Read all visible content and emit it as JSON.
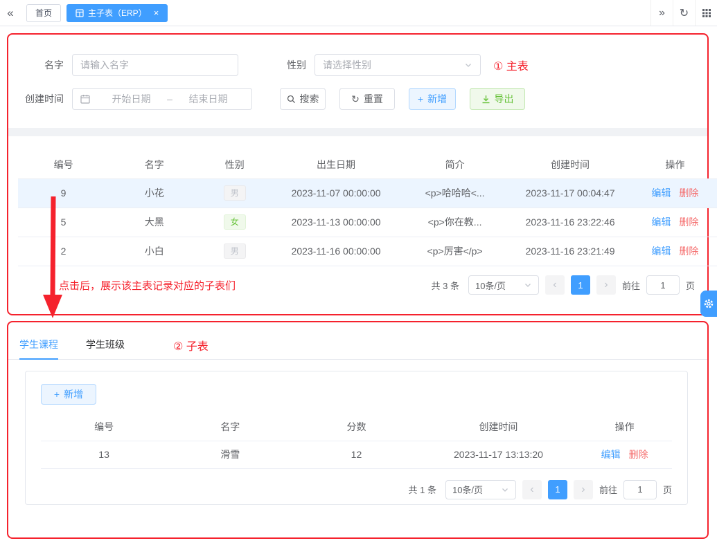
{
  "colors": {
    "primary": "#409eff",
    "success": "#67c23a",
    "danger": "#f56c6c",
    "annotation_red": "#f5222d",
    "selected_row_bg": "#ecf5ff"
  },
  "icons": {
    "collapse_left": "«",
    "expand_right": "»",
    "refresh": "↻",
    "close": "×",
    "plus": "+",
    "prev": "‹",
    "next": "›",
    "date_separator": "–"
  },
  "topbar": {
    "tabs": [
      {
        "label": "首页"
      },
      {
        "label": "主子表（ERP）"
      }
    ]
  },
  "search_form": {
    "name_label": "名字",
    "name_placeholder": "请输入名字",
    "gender_label": "性别",
    "gender_placeholder": "请选择性别",
    "created_label": "创建时间",
    "date_start_placeholder": "开始日期",
    "date_end_placeholder": "结束日期",
    "search_button": "搜索",
    "reset_button": "重置",
    "add_button": "新增",
    "export_button": "导出"
  },
  "annotations": {
    "master": "① 主表",
    "child": "② 子表",
    "click_hint": "点击后，展示该主表记录对应的子表们"
  },
  "master_table": {
    "headers": [
      "编号",
      "名字",
      "性别",
      "出生日期",
      "简介",
      "创建时间",
      "操作"
    ],
    "edit_label": "编辑",
    "delete_label": "删除",
    "rows": [
      {
        "id": "9",
        "name": "小花",
        "gender": "男",
        "birth": "2023-11-07 00:00:00",
        "intro": "<p>哈哈哈<...",
        "created": "2023-11-17 00:04:47"
      },
      {
        "id": "5",
        "name": "大黑",
        "gender": "女",
        "birth": "2023-11-13 00:00:00",
        "intro": "<p>你在教...",
        "created": "2023-11-16 23:22:46"
      },
      {
        "id": "2",
        "name": "小白",
        "gender": "男",
        "birth": "2023-11-16 00:00:00",
        "intro": "<p>厉害</p>",
        "created": "2023-11-16 23:21:49"
      }
    ],
    "pagination": {
      "total": "共 3 条",
      "page_size": "10条/页",
      "page": "1",
      "goto": "前往",
      "goto_value": "1",
      "unit": "页"
    }
  },
  "child_tabs": [
    {
      "label": "学生课程"
    },
    {
      "label": "学生班级"
    }
  ],
  "child_table": {
    "add_button": "新增",
    "headers": [
      "编号",
      "名字",
      "分数",
      "创建时间",
      "操作"
    ],
    "edit_label": "编辑",
    "delete_label": "删除",
    "rows": [
      {
        "id": "13",
        "name": "滑雪",
        "score": "12",
        "created": "2023-11-17 13:13:20"
      }
    ],
    "pagination": {
      "total": "共 1 条",
      "page_size": "10条/页",
      "page": "1",
      "goto": "前往",
      "goto_value": "1",
      "unit": "页"
    }
  }
}
